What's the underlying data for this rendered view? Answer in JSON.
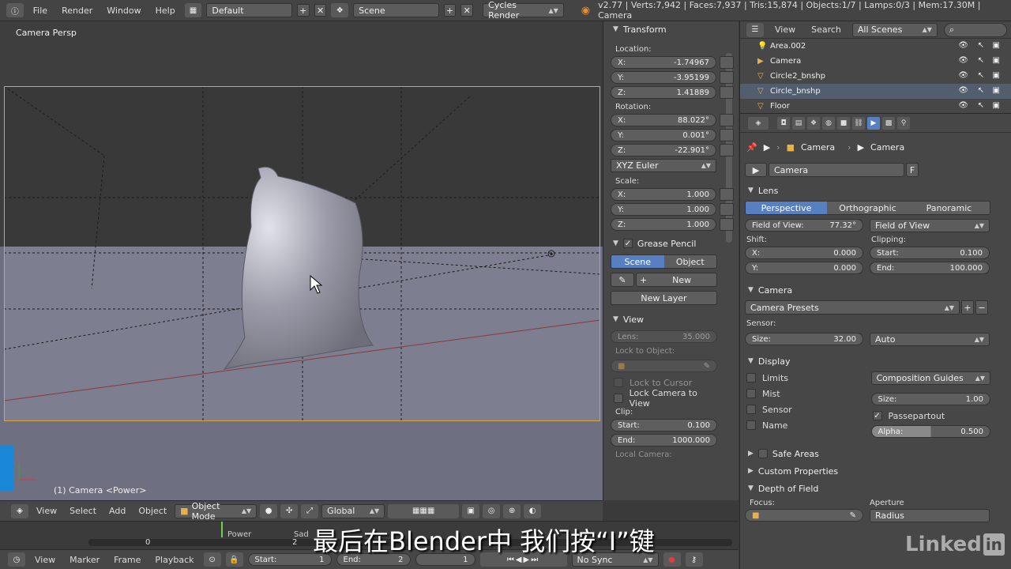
{
  "topbar": {
    "menus": [
      "File",
      "Render",
      "Window",
      "Help"
    ],
    "layout": "Default",
    "scene": "Scene",
    "engine": "Cycles Render",
    "stats": "v2.77 | Verts:7,942 | Faces:7,937 | Tris:15,874 | Objects:1/7 | Lamps:0/3 | Mem:17.30M | Camera"
  },
  "viewport": {
    "title": "Camera Persp",
    "object_label": "(1) Camera <Power>"
  },
  "vpheader": {
    "view": "View",
    "select": "Select",
    "add": "Add",
    "object": "Object",
    "mode": "Object Mode",
    "orientation": "Global"
  },
  "timeline": {
    "marker_0": "0",
    "marker_2": "2",
    "power": "Power",
    "sad": "Sad"
  },
  "timebar": {
    "view": "View",
    "marker": "Marker",
    "frame": "Frame",
    "playback": "Playback",
    "start_label": "Start:",
    "start_val": "1",
    "end_label": "End:",
    "end_val": "2",
    "current": "1",
    "sync": "No Sync"
  },
  "npanel": {
    "transform": "Transform",
    "location_label": "Location:",
    "loc": [
      {
        "l": "X:",
        "v": "-1.74967"
      },
      {
        "l": "Y:",
        "v": "-3.95199"
      },
      {
        "l": "Z:",
        "v": "1.41889"
      }
    ],
    "rotation_label": "Rotation:",
    "rot": [
      {
        "l": "X:",
        "v": "88.022°"
      },
      {
        "l": "Y:",
        "v": "0.001°"
      },
      {
        "l": "Z:",
        "v": "-22.901°"
      }
    ],
    "rot_mode": "XYZ Euler",
    "scale_label": "Scale:",
    "scale": [
      {
        "l": "X:",
        "v": "1.000"
      },
      {
        "l": "Y:",
        "v": "1.000"
      },
      {
        "l": "Z:",
        "v": "1.000"
      }
    ],
    "grease_pencil": "Grease Pencil",
    "gp_scene": "Scene",
    "gp_object": "Object",
    "gp_new": "New",
    "gp_new_layer": "New Layer",
    "view": "View",
    "lens_label": "Lens:",
    "lens_val": "35.000",
    "lock_to_object": "Lock to Object:",
    "lock_to_cursor": "Lock to Cursor",
    "lock_camera_to_view": "Lock Camera to View",
    "clip_label": "Clip:",
    "clip_start_label": "Start:",
    "clip_start_val": "0.100",
    "clip_end_label": "End:",
    "clip_end_val": "1000.000",
    "local_camera": "Local Camera:"
  },
  "outliner": {
    "view": "View",
    "search": "Search",
    "scenes": "All Scenes",
    "items": [
      "Area.002",
      "Camera",
      "Circle2_bnshp",
      "Circle_bnshp",
      "Floor"
    ]
  },
  "props": {
    "breadcrumb_obj": "Camera",
    "breadcrumb_data": "Camera",
    "datablock": "Camera",
    "datablock_flag": "F",
    "lens_section": "Lens",
    "proj_perspective": "Perspective",
    "proj_orthographic": "Orthographic",
    "proj_panoramic": "Panoramic",
    "fov_label": "Field of View:",
    "fov_val": "77.32°",
    "fov_mode": "Field of View",
    "shift_label": "Shift:",
    "shift_x_label": "X:",
    "shift_x": "0.000",
    "shift_y_label": "Y:",
    "shift_y": "0.000",
    "clipping_label": "Clipping:",
    "clip_start_label": "Start:",
    "clip_start": "0.100",
    "clip_end_label": "End:",
    "clip_end": "100.000",
    "camera_section": "Camera",
    "camera_presets": "Camera Presets",
    "sensor_label": "Sensor:",
    "size_label": "Size:",
    "size_val": "32.00",
    "sensor_fit": "Auto",
    "display_section": "Display",
    "limits": "Limits",
    "mist": "Mist",
    "sensor": "Sensor",
    "name": "Name",
    "comp_guides": "Composition Guides",
    "disp_size_label": "Size:",
    "disp_size_val": "1.00",
    "passepartout": "Passepartout",
    "alpha_label": "Alpha:",
    "alpha_val": "0.500",
    "safe_areas": "Safe Areas",
    "custom_properties": "Custom Properties",
    "dof": "Depth of Field",
    "focus_label": "Focus:",
    "aperture_label": "Aperture",
    "radius": "Radius"
  },
  "overlay": {
    "subtitle": "最后在Blender中 我们按“I”键",
    "brand_word": "Linked",
    "brand_box": "in"
  },
  "colors": {
    "accent": "#5680c2",
    "camera_frame": "#d9a441"
  }
}
